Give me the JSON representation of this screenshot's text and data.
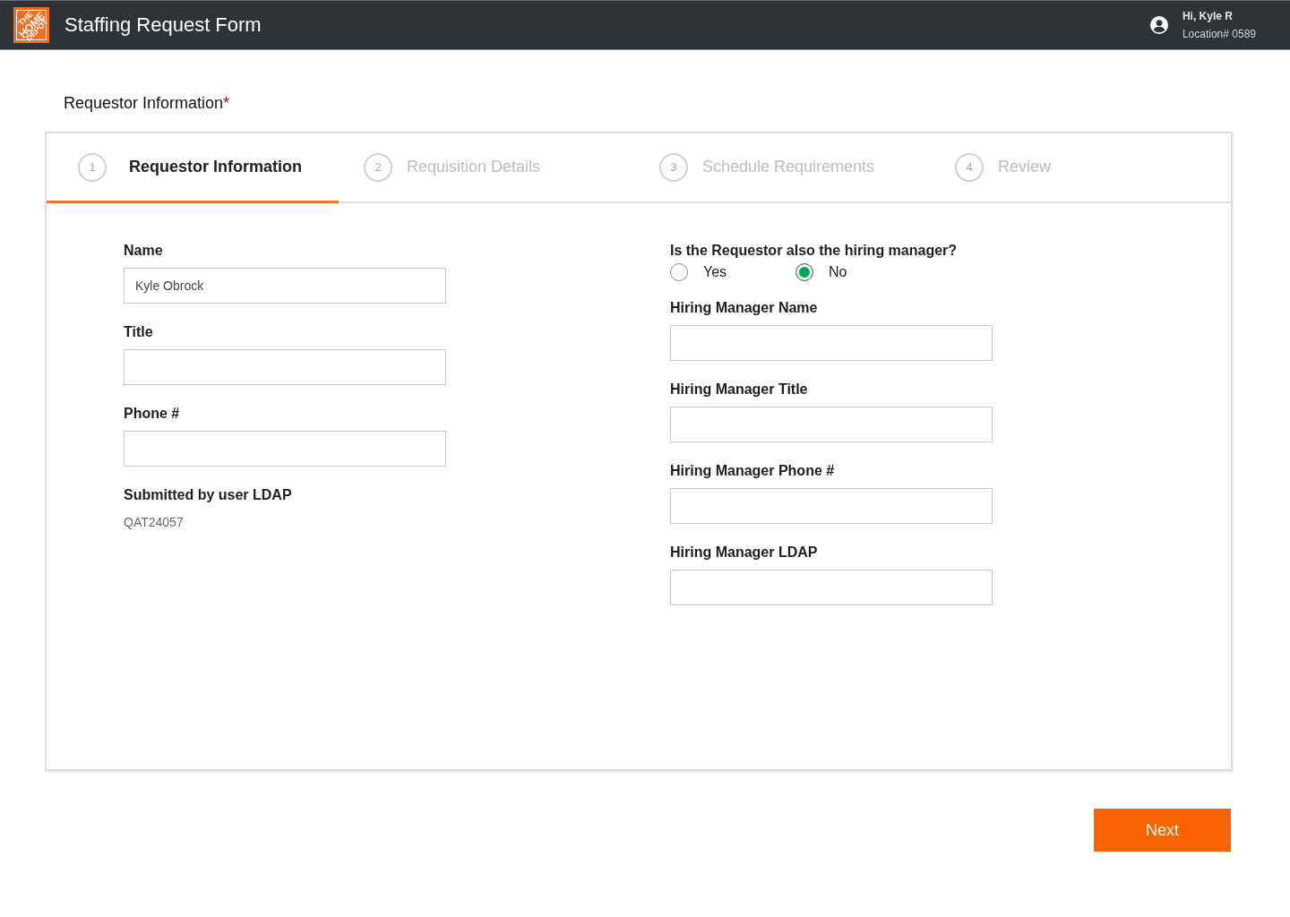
{
  "header": {
    "logo": {
      "lines": [
        "THE",
        "HOME",
        "DEPOT"
      ]
    },
    "title": "Staffing Request Form",
    "user": {
      "greeting": "Hi, Kyle R",
      "location": "Location# 0589"
    }
  },
  "section": {
    "title": "Requestor Information",
    "required_mark": "*"
  },
  "steps": [
    {
      "number": "1",
      "label": "Requestor Information",
      "selected": true
    },
    {
      "number": "2",
      "label": "Requisition Details",
      "selected": false
    },
    {
      "number": "3",
      "label": "Schedule Requirements",
      "selected": false
    },
    {
      "number": "4",
      "label": "Review",
      "selected": false
    }
  ],
  "left_fields": [
    {
      "kind": "input",
      "label": "Name",
      "value": "Kyle Obrock"
    },
    {
      "kind": "input",
      "label": "Title"
    },
    {
      "kind": "input",
      "label": "Phone #"
    },
    {
      "kind": "readonly",
      "label": "Submitted by user LDAP",
      "value": "QAT24057"
    }
  ],
  "right_fields": [
    {
      "kind": "radio",
      "label": "Is the Requestor also the hiring manager?",
      "options": [
        {
          "label": "Yes",
          "selected": false
        },
        {
          "label": "No",
          "selected": true
        }
      ]
    },
    {
      "kind": "input",
      "label": "Hiring Manager Name"
    },
    {
      "kind": "input",
      "label": "Hiring Manager Title"
    },
    {
      "kind": "input",
      "label": "Hiring Manager Phone #"
    },
    {
      "kind": "input",
      "label": "Hiring Manager LDAP"
    }
  ],
  "next_button": "Next"
}
